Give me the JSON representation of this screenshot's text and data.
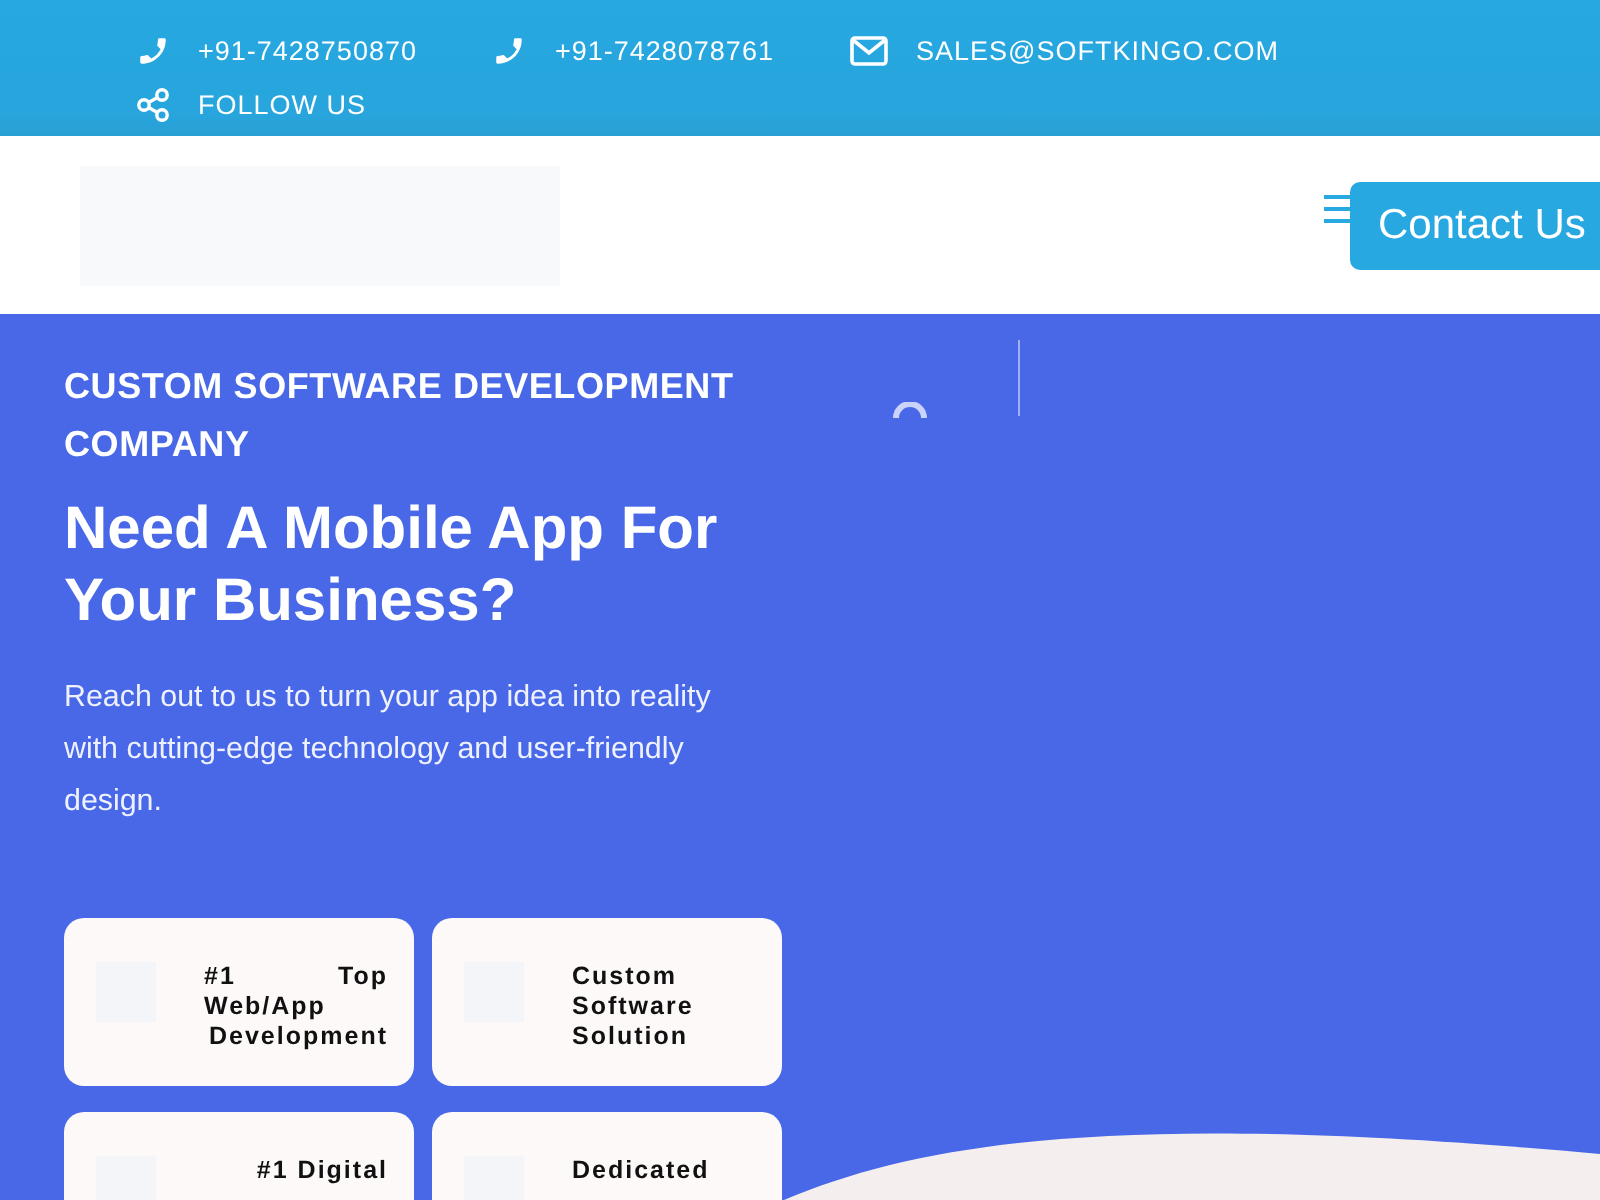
{
  "top_bar": {
    "contacts": [
      {
        "kind": "phone",
        "text": "+91-7428750870"
      },
      {
        "kind": "phone",
        "text": "+91-7428078761"
      },
      {
        "kind": "mail",
        "text": "SALES@SOFTKINGO.COM"
      }
    ],
    "follow": {
      "kind": "share",
      "text": "FOLLOW US"
    }
  },
  "header": {
    "contact_button": "Contact Us"
  },
  "hero": {
    "eyebrow": "CUSTOM SOFTWARE DEVELOPMENT COMPANY",
    "title": "Need A Mobile App For Your Business?",
    "description": "Reach out to us to turn your app idea into reality with cutting-edge technology and user-friendly design.",
    "features": [
      {
        "label": "#1 Top Web/App Development"
      },
      {
        "label": "Custom Software Solution"
      },
      {
        "label": "#1 Digital"
      },
      {
        "label": "Dedicated"
      }
    ]
  }
}
